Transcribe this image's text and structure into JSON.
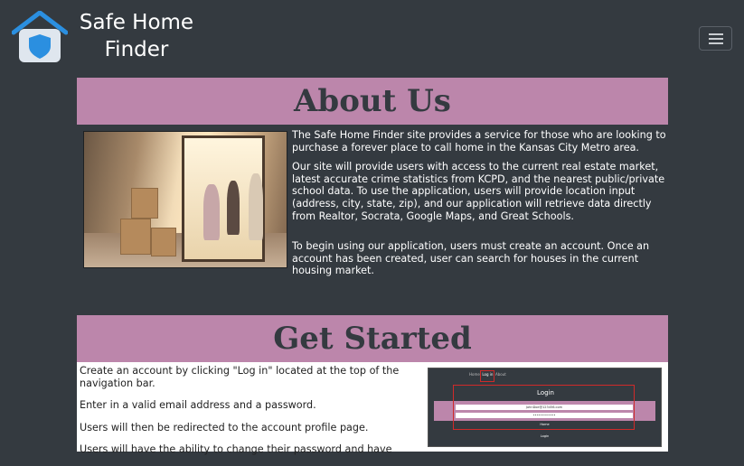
{
  "navbar": {
    "brand_line1": "Safe Home",
    "brand_line2": "Finder"
  },
  "about": {
    "title": "About Us",
    "paragraphs": [
      "The Safe Home Finder site provides a service for those who are looking to purchase a forever place to call home in the Kansas City Metro area.",
      "Our site will provide users with access to the current real estate market, latest accurate crime statistics from KCPD, and the nearest public/private school data. To use the application, users will provide location input (address, city, state, zip), and our application will retrieve data directly from Realtor, Socrata, Google Maps, and Great Schools.",
      "To begin using our application, users must create an account. Once an account has been created, user can search for houses in the current housing market."
    ]
  },
  "get_started": {
    "title": "Get Started",
    "paragraphs": [
      "Create an account by clicking \"Log in\" located at the top of the navigation bar.",
      "Enter in a valid email address and a password.",
      "Users will then be redirected to the account profile page.",
      "Users will have the ability to change their password and have"
    ],
    "screenshot": {
      "nav_home": "Home",
      "nav_login": "Log in",
      "nav_about": "About",
      "title": "Login",
      "email_value": "JohnDoe@123456.com",
      "password_value": "••••••••••••",
      "button1": "Home",
      "button2": "Login"
    }
  },
  "colors": {
    "background": "#343a40",
    "header_pink": "#bc86ab",
    "header_text": "#343a40",
    "logo_blue": "#2b8fe0"
  },
  "icons": [
    "house-shield-logo-icon",
    "hamburger-menu-icon"
  ]
}
